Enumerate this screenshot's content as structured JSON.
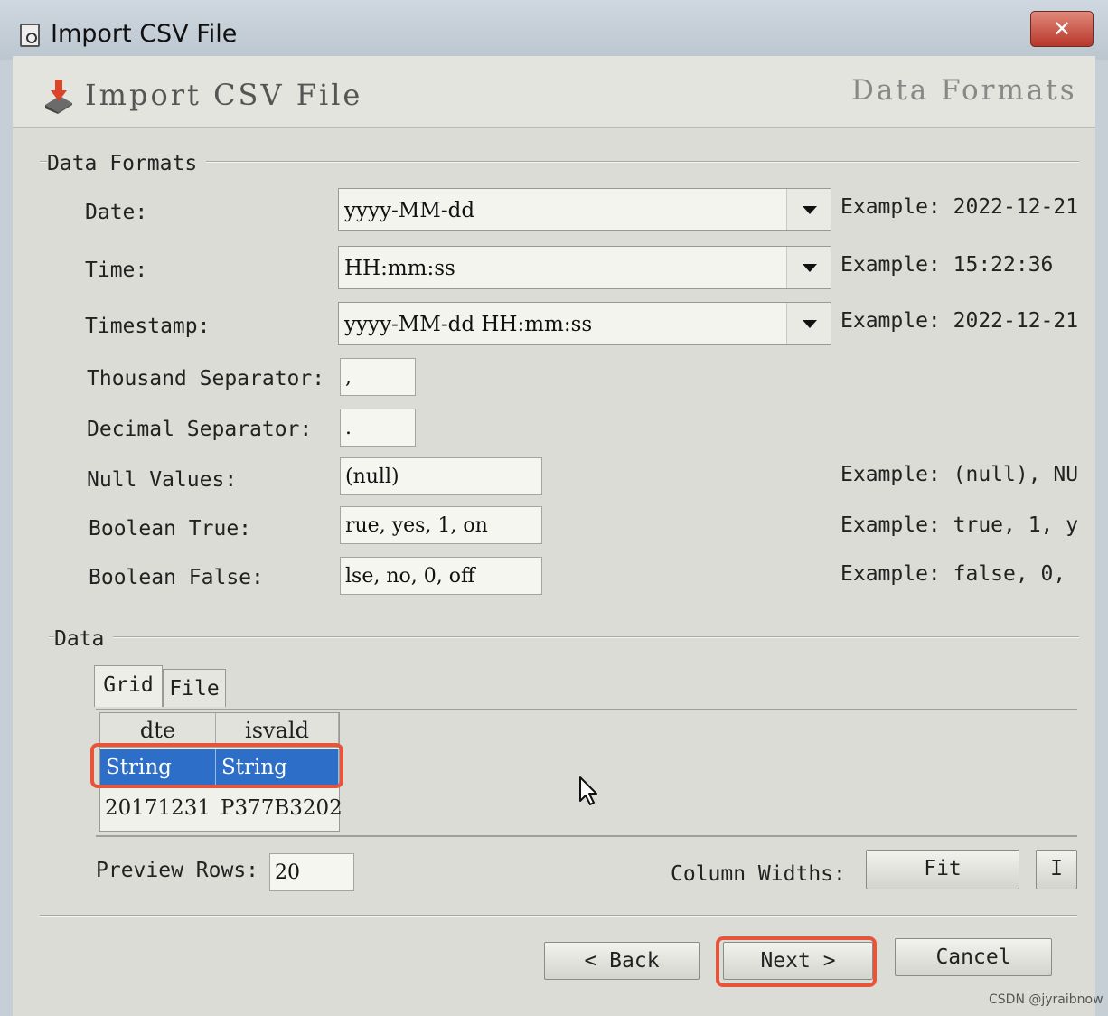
{
  "window": {
    "title": "Import CSV File",
    "close_label": "✕"
  },
  "header": {
    "title": "Import CSV File",
    "subtitle": "Data Formats"
  },
  "data_formats": {
    "group_label": "Data Formats",
    "date": {
      "label": "Date:",
      "value": "yyyy-MM-dd",
      "example": "Example: 2022-12-21"
    },
    "time": {
      "label": "Time:",
      "value": "HH:mm:ss",
      "example": "Example: 15:22:36"
    },
    "timestamp": {
      "label": "Timestamp:",
      "value": "yyyy-MM-dd HH:mm:ss",
      "example": "Example: 2022-12-21"
    },
    "thousand_separator": {
      "label": "Thousand Separator:",
      "value": ","
    },
    "decimal_separator": {
      "label": "Decimal Separator:",
      "value": "."
    },
    "null_values": {
      "label": "Null Values:",
      "value": "(null)",
      "example": "Example: (null), NU"
    },
    "boolean_true": {
      "label": "Boolean True:",
      "value": "rue, yes, 1, on",
      "example": "Example: true, 1, y"
    },
    "boolean_false": {
      "label": "Boolean False:",
      "value": "lse, no, 0, off",
      "example": "Example: false, 0,"
    }
  },
  "data": {
    "group_label": "Data",
    "tabs": [
      {
        "label": "Grid"
      },
      {
        "label": "File"
      }
    ],
    "grid": {
      "columns": [
        "dte",
        "isvald"
      ],
      "types": [
        "String",
        "String"
      ],
      "rows": [
        [
          "20171231",
          "P377B3202"
        ]
      ]
    },
    "preview_rows": {
      "label": "Preview Rows:",
      "value": "20"
    },
    "column_widths": {
      "label": "Column Widths:",
      "fit_label": "Fit",
      "extra_label": "I"
    }
  },
  "footer": {
    "back_label": "< Back",
    "next_label": "Next >",
    "cancel_label": "Cancel"
  },
  "watermark": "CSDN @jyraibnow"
}
